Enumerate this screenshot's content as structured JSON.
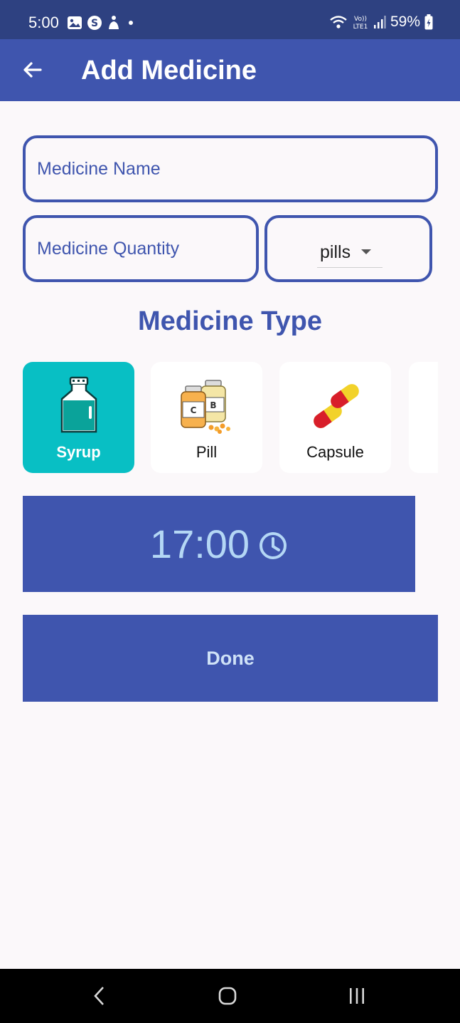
{
  "status_bar": {
    "time": "5:00",
    "battery": "59%",
    "left_icons": [
      "image-icon",
      "s-icon",
      "app-icon",
      "dot-icon"
    ],
    "right_icons": [
      "wifi-icon",
      "volte-icon",
      "signal-icon",
      "battery-icon"
    ]
  },
  "app_bar": {
    "title": "Add Medicine",
    "back_icon": "arrow-left-icon"
  },
  "form": {
    "name_placeholder": "Medicine Name",
    "quantity_placeholder": "Medicine Quantity",
    "unit_selected": "pills"
  },
  "medicine_type": {
    "heading": "Medicine Type",
    "options": [
      {
        "label": "Syrup",
        "icon": "syrup-bottle-icon",
        "selected": true
      },
      {
        "label": "Pill",
        "icon": "pill-bottles-icon",
        "selected": false
      },
      {
        "label": "Capsule",
        "icon": "capsule-icon",
        "selected": false
      },
      {
        "label": "",
        "icon": "partial-card-icon",
        "selected": false
      }
    ]
  },
  "time": {
    "value": "17:00",
    "icon": "clock-icon"
  },
  "done_label": "Done",
  "colors": {
    "status_bar": "#2e4181",
    "primary": "#3f55ae",
    "selected_card": "#08bfc4",
    "background": "#fbf8fa",
    "time_text": "#b4d7f5"
  },
  "nav_bar": {
    "icons": [
      "back-nav-icon",
      "home-nav-icon",
      "recents-nav-icon"
    ]
  }
}
